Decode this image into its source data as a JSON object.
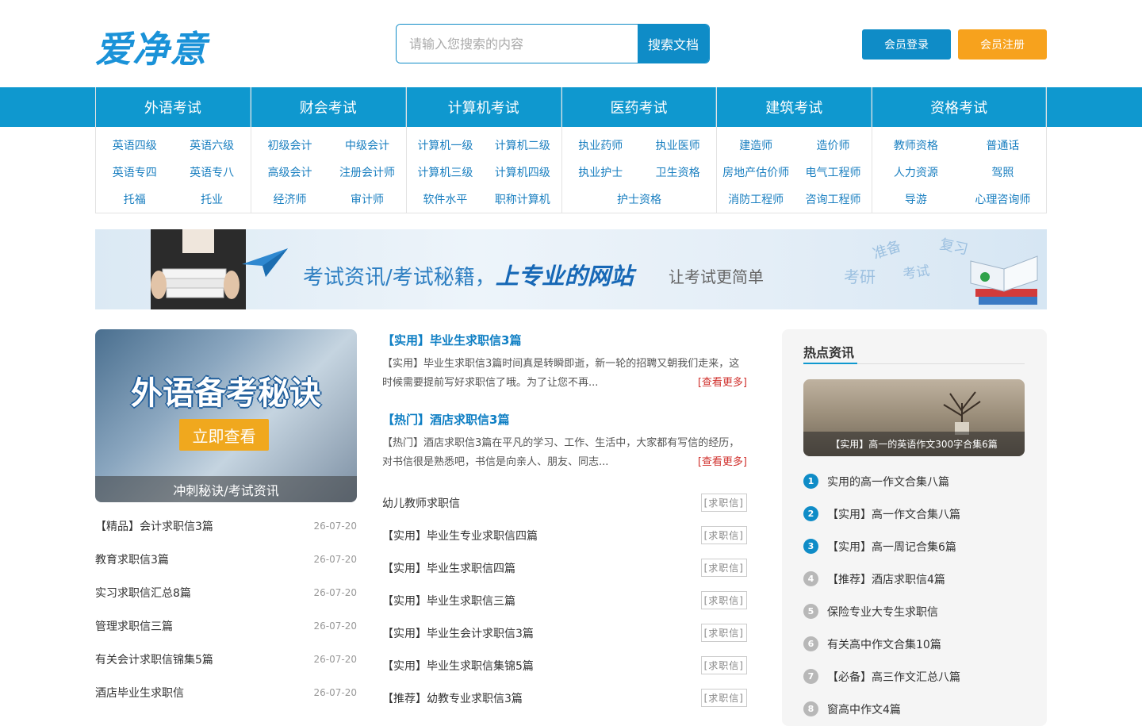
{
  "header": {
    "logo": "爱净意",
    "search_placeholder": "请输入您搜索的内容",
    "search_button": "搜索文档",
    "login_button": "会员登录",
    "register_button": "会员注册"
  },
  "nav": [
    {
      "title": "外语考试",
      "links": [
        "英语四级",
        "英语六级",
        "英语专四",
        "英语专八",
        "托福",
        "托业"
      ]
    },
    {
      "title": "财会考试",
      "links": [
        "初级会计",
        "中级会计",
        "高级会计",
        "注册会计师",
        "经济师",
        "审计师"
      ]
    },
    {
      "title": "计算机考试",
      "links": [
        "计算机一级",
        "计算机二级",
        "计算机三级",
        "计算机四级",
        "软件水平",
        "职称计算机"
      ]
    },
    {
      "title": "医药考试",
      "links": [
        "执业药师",
        "执业医师",
        "执业护士",
        "卫生资格"
      ],
      "wide_link": "护士资格"
    },
    {
      "title": "建筑考试",
      "links": [
        "建造师",
        "造价师",
        "房地产估价师",
        "电气工程师",
        "消防工程师",
        "咨询工程师"
      ]
    },
    {
      "title": "资格考试",
      "links": [
        "教师资格",
        "普通话",
        "人力资源",
        "驾照",
        "导游",
        "心理咨询师"
      ]
    }
  ],
  "banner": {
    "main_prefix": "考试资讯/考试秘籍，",
    "main_strong": "上专业的网站",
    "sub": "让考试更简单",
    "words": [
      "准备",
      "复习",
      "考研",
      "考试"
    ]
  },
  "promo": {
    "title": "外语备考秘诀",
    "button": "立即查看",
    "caption": "冲刺秘诀/考试资讯"
  },
  "left_list": [
    {
      "title": "【精品】会计求职信3篇",
      "date": "26-07-20"
    },
    {
      "title": "教育求职信3篇",
      "date": "26-07-20"
    },
    {
      "title": "实习求职信汇总8篇",
      "date": "26-07-20"
    },
    {
      "title": "管理求职信三篇",
      "date": "26-07-20"
    },
    {
      "title": "有关会计求职信锦集5篇",
      "date": "26-07-20"
    },
    {
      "title": "酒店毕业生求职信",
      "date": "26-07-20"
    }
  ],
  "articles": [
    {
      "title": "【实用】毕业生求职信3篇",
      "desc": "【实用】毕业生求职信3篇时间真是转瞬即逝，新一轮的招聘又朝我们走来，这时候需要提前写好求职信了哦。为了让您不再...",
      "more": "[查看更多]"
    },
    {
      "title": "【热门】酒店求职信3篇",
      "desc": "【热门】酒店求职信3篇在平凡的学习、工作、生活中，大家都有写信的经历，对书信很是熟悉吧，书信是向亲人、朋友、同志...",
      "more": "[查看更多]"
    }
  ],
  "mid_list": [
    {
      "title": "幼儿教师求职信",
      "tag": "[求职信]"
    },
    {
      "title": "【实用】毕业生专业求职信四篇",
      "tag": "[求职信]"
    },
    {
      "title": "【实用】毕业生求职信四篇",
      "tag": "[求职信]"
    },
    {
      "title": "【实用】毕业生求职信三篇",
      "tag": "[求职信]"
    },
    {
      "title": "【实用】毕业生会计求职信3篇",
      "tag": "[求职信]"
    },
    {
      "title": "【实用】毕业生求职信集锦5篇",
      "tag": "[求职信]"
    },
    {
      "title": "【推荐】幼教专业求职信3篇",
      "tag": "[求职信]"
    }
  ],
  "hot": {
    "title": "热点资讯",
    "feature_caption": "【实用】高一的英语作文300字合集6篇",
    "items": [
      {
        "num": "1",
        "title": "实用的高一作文合集八篇"
      },
      {
        "num": "2",
        "title": "【实用】高一作文合集八篇"
      },
      {
        "num": "3",
        "title": "【实用】高一周记合集6篇"
      },
      {
        "num": "4",
        "title": "【推荐】酒店求职信4篇"
      },
      {
        "num": "5",
        "title": "保险专业大专生求职信"
      },
      {
        "num": "6",
        "title": "有关高中作文合集10篇"
      },
      {
        "num": "7",
        "title": "【必备】高三作文汇总八篇"
      },
      {
        "num": "8",
        "title": "窗高中作文4篇"
      }
    ]
  },
  "colors": {
    "brand_blue": "#0f98cf",
    "accent_orange": "#f7a21d",
    "link_blue": "#1a7fc0",
    "more_red": "#d0312d"
  }
}
